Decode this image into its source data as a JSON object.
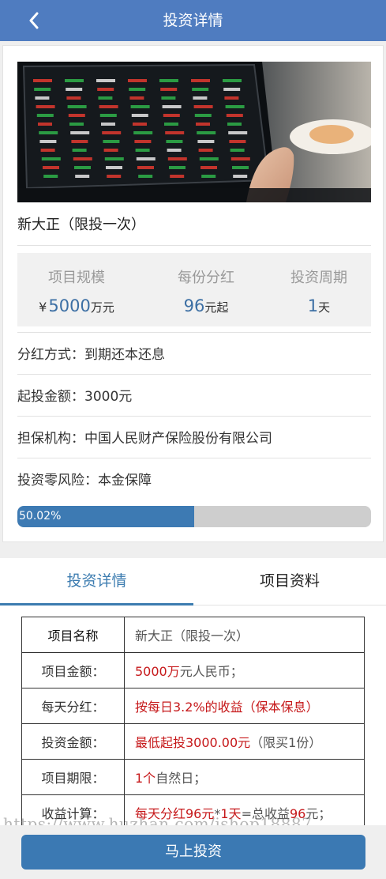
{
  "header": {
    "title": "投资详情",
    "back_icon": "chevron-left-icon"
  },
  "project": {
    "name": "新大正（限投一次）",
    "stats": [
      {
        "label": "项目规模",
        "prefix": "¥",
        "value": "5000",
        "unit": "万元"
      },
      {
        "label": "每份分红",
        "prefix": "",
        "value": "96",
        "unit": "元起"
      },
      {
        "label": "投资周期",
        "prefix": "",
        "value": "1",
        "unit": "天"
      }
    ],
    "info": [
      "分红方式：到期还本还息",
      "起投金额：3000元",
      "担保机构：中国人民财产保险股份有限公司",
      "投资零风险：本金保障"
    ],
    "progress": {
      "percent": 50.02,
      "label": "50.02%"
    }
  },
  "tabs": [
    {
      "label": "投资详情",
      "active": true
    },
    {
      "label": "项目资料",
      "active": false
    }
  ],
  "detail_table": {
    "header": {
      "key": "项目名称",
      "value": "新大正（限投一次）"
    },
    "rows": [
      {
        "key": "项目金额：",
        "parts": [
          {
            "t": "5000万",
            "red": true
          },
          {
            "t": "元人民币；",
            "red": false
          }
        ]
      },
      {
        "key": "每天分红：",
        "parts": [
          {
            "t": "按每日3.2%的收益（保本保息）",
            "red": true
          }
        ]
      },
      {
        "key": "投资金额：",
        "parts": [
          {
            "t": "最低起投3000.00元",
            "red": true
          },
          {
            "t": "（限买1份）",
            "red": false
          }
        ]
      },
      {
        "key": "项目期限：",
        "parts": [
          {
            "t": "1个",
            "red": true
          },
          {
            "t": "自然日；",
            "red": false
          }
        ]
      },
      {
        "key": "收益计算：",
        "parts": [
          {
            "t": "每天分红96元",
            "red": true
          },
          {
            "t": "*",
            "red": false
          },
          {
            "t": "1天",
            "red": true
          },
          {
            "t": "=总收益",
            "red": false
          },
          {
            "t": "96",
            "red": true
          },
          {
            "t": "元；",
            "red": false
          }
        ]
      }
    ]
  },
  "watermark": "https://www.huzhan.com/ishop18887",
  "action": {
    "invest_label": "马上投资"
  },
  "colors": {
    "header": "#4f7cc0",
    "accent": "#3c7cb0",
    "highlight": "#c6181a",
    "progress": "#3d7ab3"
  }
}
